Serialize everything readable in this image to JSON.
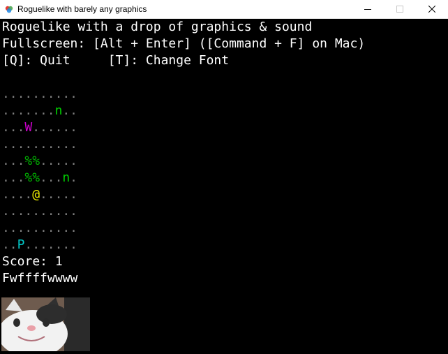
{
  "window": {
    "title": "Roguelike with barely any graphics"
  },
  "header": {
    "line1": "Roguelike with a drop of graphics & sound",
    "line2": "Fullscreen: [Alt + Enter] ([Command + F] on Mac)",
    "line3": "[Q]: Quit     [T]: Change Font"
  },
  "map": {
    "rows": [
      "..........",
      ".......n..",
      "...W......",
      "..........",
      "...%%.....",
      "...%%...n.",
      "....@.....",
      "..........",
      "..........",
      "..P......."
    ],
    "colors": {
      "floor": "#7f7f7f",
      "n": "#00d000",
      "W": "#d000d0",
      "%": "#00b000",
      "@": "#f0f000",
      "P": "#00c8c8"
    }
  },
  "status": {
    "score": "Score: 1",
    "sound": "Fwffffwwww"
  }
}
